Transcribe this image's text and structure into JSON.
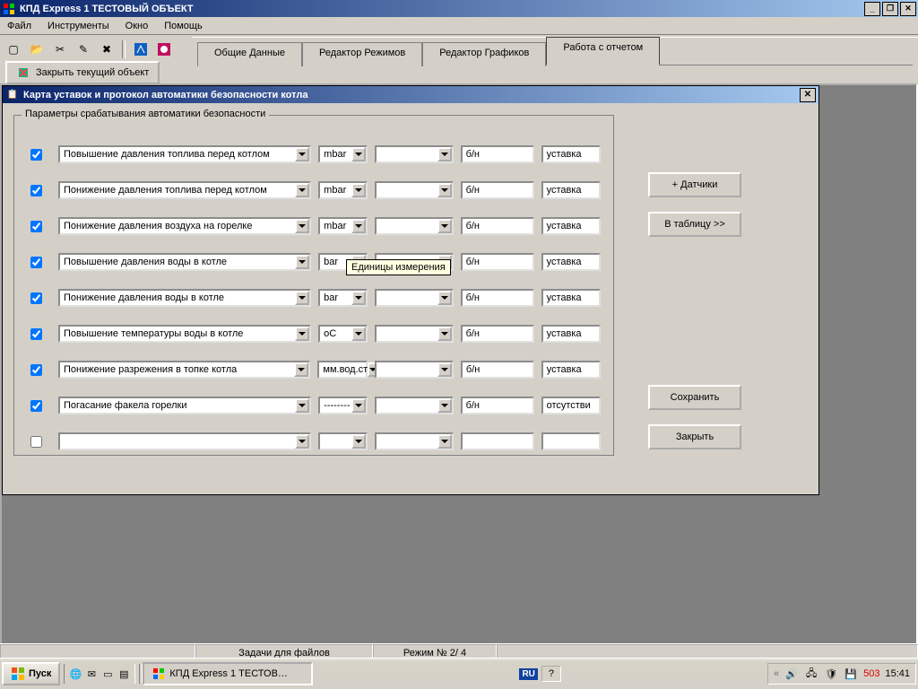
{
  "app": {
    "title": "КПД Express   1 ТЕСТОВЫЙ ОБЪЕКТ",
    "menus": [
      "Файл",
      "Инструменты",
      "Окно",
      "Помощь"
    ],
    "close_object": "Закрыть текущий объект",
    "tabs": [
      "Общие   Данные",
      "Редактор   Режимов",
      "Редактор   Графиков",
      "Работа   с   отчетом"
    ],
    "active_tab": 3
  },
  "dialog": {
    "title": "Карта уставок  и  протокол  автоматики  безопасности котла",
    "group_legend": "Параметры срабатывания автоматики безопасности",
    "tooltip": "Единицы измерения",
    "rows": [
      {
        "checked": true,
        "param": "Повышение давления топлива перед котлом",
        "unit": "mbar",
        "val": "",
        "sn": "б/н",
        "note": "уставка"
      },
      {
        "checked": true,
        "param": "Понижение давления топлива перед котлом",
        "unit": "mbar",
        "val": "",
        "sn": "б/н",
        "note": "уставка"
      },
      {
        "checked": true,
        "param": "Понижение давления воздуха  на горелке",
        "unit": "mbar",
        "val": "",
        "sn": "б/н",
        "note": "уставка"
      },
      {
        "checked": true,
        "param": "Повышение давления воды в котле",
        "unit": "bar",
        "val": "",
        "sn": "б/н",
        "note": "уставка"
      },
      {
        "checked": true,
        "param": "Понижение давления воды  в котле",
        "unit": "bar",
        "val": "",
        "sn": "б/н",
        "note": "уставка"
      },
      {
        "checked": true,
        "param": "Повышение температуры воды в котле",
        "unit": "oC",
        "val": "",
        "sn": "б/н",
        "note": "уставка"
      },
      {
        "checked": true,
        "param": "Понижение разрежения в топке котла",
        "unit": "мм.вод.ст",
        "val": "",
        "sn": "б/н",
        "note": "уставка"
      },
      {
        "checked": true,
        "param": "Погасание факела горелки",
        "unit": "--------",
        "val": "",
        "sn": "б/н",
        "note": "отсутстви"
      },
      {
        "checked": false,
        "param": "",
        "unit": "",
        "val": "",
        "sn": "",
        "note": ""
      }
    ],
    "buttons": {
      "add_sensors": "+ Датчики",
      "to_table": "В таблицу >>",
      "save": "Сохранить",
      "close": "Закрыть"
    }
  },
  "status": {
    "cell1": "Задачи для файлов",
    "cell2": "Режим № 2/ 4"
  },
  "taskbar": {
    "start": "Пуск",
    "task": "КПД Express   1 ТЕСТОВ…",
    "lang": "RU",
    "tray_text": "503",
    "clock": "15:41"
  }
}
